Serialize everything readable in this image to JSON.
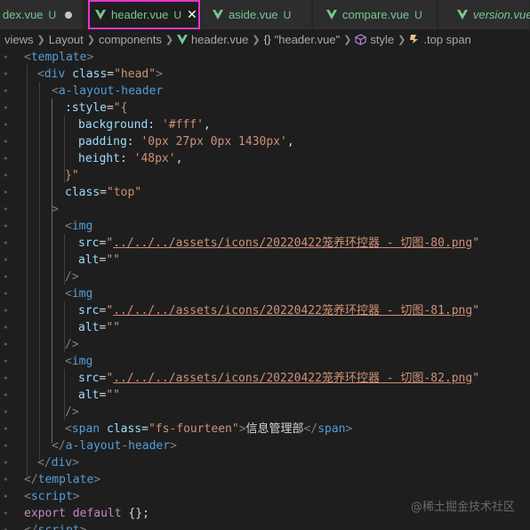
{
  "tabs": [
    {
      "name": "dex.vue",
      "status": "U",
      "indicator": "dot",
      "icon": "none"
    },
    {
      "name": "header.vue",
      "status": "U",
      "indicator": "close",
      "icon": "vue-icon",
      "active": true
    },
    {
      "name": "aside.vue",
      "status": "U",
      "icon": "vue-icon"
    },
    {
      "name": "compare.vue",
      "status": "U",
      "icon": "vue-icon"
    },
    {
      "name": "version.vue",
      "icon": "vue-icon"
    }
  ],
  "breadcrumb": {
    "views": "views",
    "layout": "Layout",
    "components": "components",
    "file": "header.vue",
    "braces": "{}",
    "object": "\"header.vue\"",
    "style": "style",
    "selector": ".top span"
  },
  "code": {
    "l1": [
      "<",
      "template",
      ">"
    ],
    "l2": [
      "<",
      "div",
      "class",
      "=",
      "\"head\"",
      ">"
    ],
    "l3": [
      "<",
      "a-layout-header"
    ],
    "l4": [
      ":style",
      "=",
      "\"{"
    ],
    "l5": [
      "background",
      ": ",
      "'#fff'",
      ","
    ],
    "l6": [
      "padding",
      ": ",
      "'0px 27px 0px 1430px'",
      ","
    ],
    "l7": [
      "height",
      ": ",
      "'48px'",
      ","
    ],
    "l8": [
      "}\""
    ],
    "l9": [
      "class",
      "=",
      "\"top\""
    ],
    "l10": [
      ">"
    ],
    "img": [
      "<",
      "img"
    ],
    "src_attr": "src",
    "eq": "=",
    "q": "\"",
    "src80": "../../../assets/icons/20220422笼养环控器 - 切图-80.png",
    "src81": "../../../assets/icons/20220422笼养环控器 - 切图-81.png",
    "src82": "../../../assets/icons/20220422笼养环控器 - 切图-82.png",
    "alt_attr": "alt",
    "alt_val": "\"\"",
    "selfclose": "/>",
    "span_open": [
      "<",
      "span",
      "class",
      "=",
      "\"fs-fourteen\"",
      ">"
    ],
    "span_text": "信息管理部",
    "span_close": [
      "</",
      "span",
      ">"
    ],
    "header_close": [
      "</",
      "a-layout-header",
      ">"
    ],
    "div_close": [
      "</",
      "div",
      ">"
    ],
    "template_close": [
      "</",
      "template",
      ">"
    ],
    "script_open": [
      "<",
      "script",
      ">"
    ],
    "export": "export",
    "default": "default",
    "empty_obj": "{};",
    "script_close": [
      "</",
      "script",
      ">"
    ]
  },
  "watermark": "@稀土掘金技术社区",
  "colors": {
    "highlight_border": "#e636cf",
    "vue_green": "#73c991",
    "editor_bg": "#1e1e1e"
  }
}
